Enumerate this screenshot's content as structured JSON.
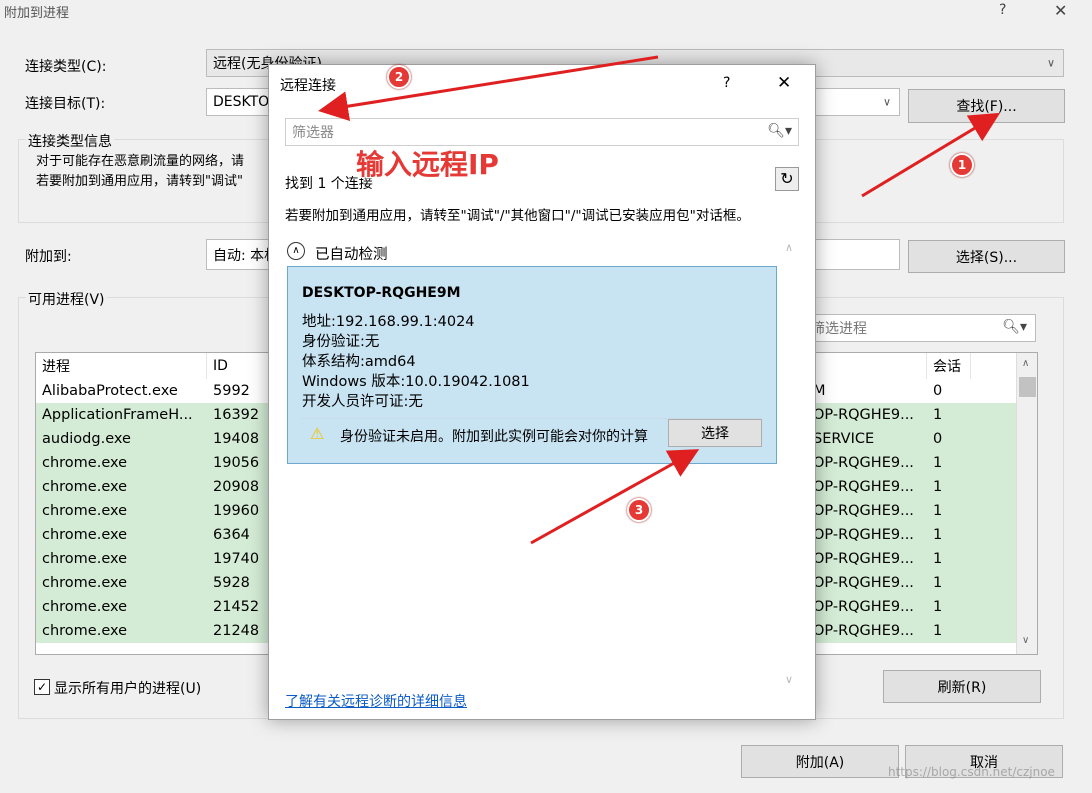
{
  "window": {
    "title": "附加到进程",
    "help": "?",
    "close": "✕"
  },
  "connection": {
    "type_label": "连接类型(C):",
    "type_value": "远程(无身份验证)",
    "target_label": "连接目标(T):",
    "target_value": "DESKTOP",
    "find_button": "查找(F)..."
  },
  "info_group": {
    "title": "连接类型信息",
    "line1": "对于可能存在恶意刷流量的网络，请",
    "line2": "若要附加到通用应用，请转到\"调试\""
  },
  "attach_to": {
    "label": "附加到:",
    "value": "自动: 本机",
    "select_button": "选择(S)..."
  },
  "processes": {
    "group_title": "可用进程(V)",
    "filter_placeholder": "筛选进程",
    "col_process": "进程",
    "col_id": "ID",
    "col_session": "会话",
    "rows": [
      {
        "name": "AlibabaProtect.exe",
        "id": "5992",
        "user": "M",
        "session": "0"
      },
      {
        "name": "ApplicationFrameH...",
        "id": "16392",
        "user": "OP-RQGHE9...",
        "session": "1"
      },
      {
        "name": "audiodg.exe",
        "id": "19408",
        "user": "SERVICE",
        "session": "0"
      },
      {
        "name": "chrome.exe",
        "id": "19056",
        "user": "OP-RQGHE9...",
        "session": "1"
      },
      {
        "name": "chrome.exe",
        "id": "20908",
        "user": "OP-RQGHE9...",
        "session": "1"
      },
      {
        "name": "chrome.exe",
        "id": "19960",
        "user": "OP-RQGHE9...",
        "session": "1"
      },
      {
        "name": "chrome.exe",
        "id": "6364",
        "user": "OP-RQGHE9...",
        "session": "1"
      },
      {
        "name": "chrome.exe",
        "id": "19740",
        "user": "OP-RQGHE9...",
        "session": "1"
      },
      {
        "name": "chrome.exe",
        "id": "5928",
        "user": "OP-RQGHE9...",
        "session": "1"
      },
      {
        "name": "chrome.exe",
        "id": "21452",
        "user": "OP-RQGHE9...",
        "session": "1"
      },
      {
        "name": "chrome.exe",
        "id": "21248",
        "user": "OP-RQGHE9...",
        "session": "1"
      }
    ],
    "show_all_label": "显示所有用户的进程(U)",
    "refresh_button": "刷新(R)"
  },
  "footer": {
    "attach_button": "附加(A)",
    "cancel_button": "取消",
    "watermark": "https://blog.csdn.net/czjnoe"
  },
  "dialog": {
    "title": "远程连接",
    "help": "?",
    "close": "✕",
    "filter_placeholder": "筛选器",
    "found_text": "找到 1 个连接",
    "hint": "若要附加到通用应用，请转至\"调试\"/\"其他窗口\"/\"调试已安装应用包\"对话框。",
    "section_title": "已自动检测",
    "machine": {
      "name": "DESKTOP-RQGHE9M",
      "address": "地址:192.168.99.1:4024",
      "auth": "身份验证:无",
      "arch": "体系结构:amd64",
      "windows": "Windows 版本:10.0.19042.1081",
      "dev_license": "开发人员许可证:无"
    },
    "warning": "身份验证未启用。附加到此实例可能会对你的计算",
    "select_button": "选择",
    "learn_more": "了解有关远程诊断的详细信息"
  },
  "annotations": {
    "overlay_text": "输入远程IP",
    "badge1": "1",
    "badge2": "2",
    "badge3": "3",
    "arrow_color": "#e02020"
  }
}
